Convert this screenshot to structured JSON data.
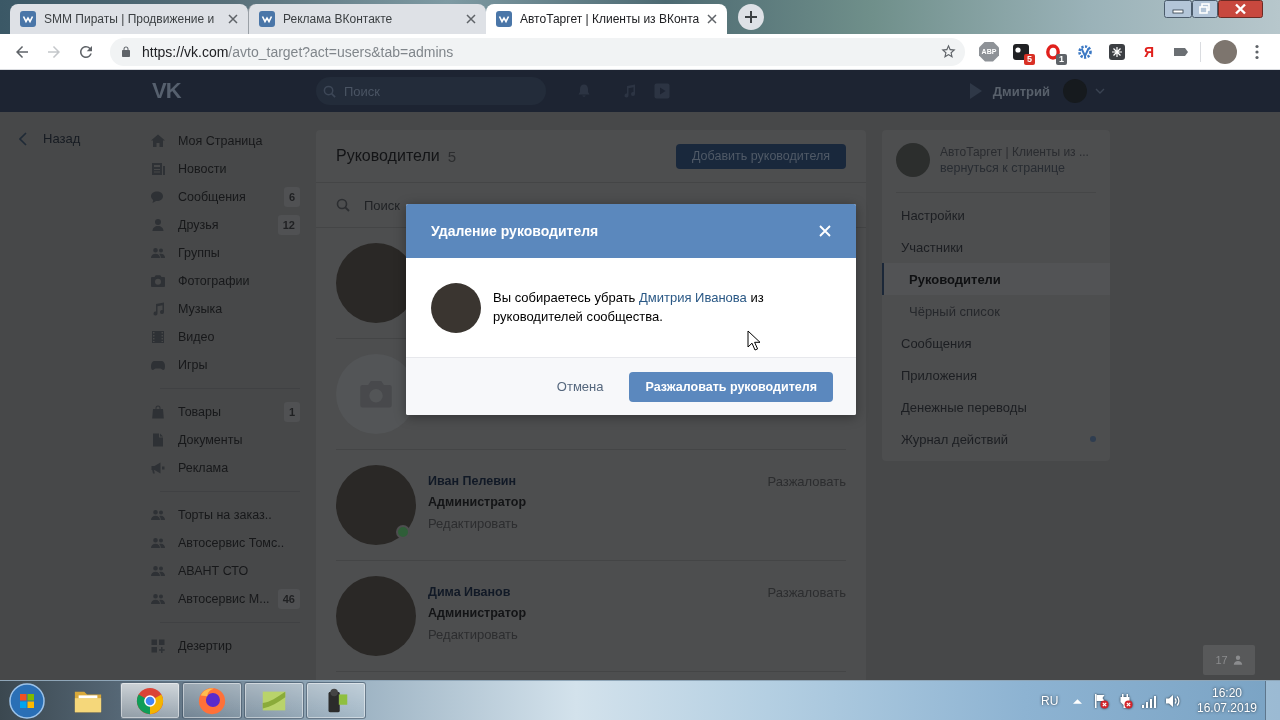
{
  "browser": {
    "tabs": [
      {
        "title": "SMM Пираты | Продвижение и",
        "selected": false
      },
      {
        "title": "Реклама ВКонтакте",
        "selected": false
      },
      {
        "title": "АвтоТаргет | Клиенты из ВКонта",
        "selected": true
      }
    ],
    "nav_buttons": [
      {
        "kind": "back",
        "disabled": false
      },
      {
        "kind": "forward",
        "disabled": true
      },
      {
        "kind": "reload",
        "disabled": false
      }
    ],
    "url_host": "https://vk.com",
    "url_path": "/avto_target?act=users&tab=admins",
    "extensions": [
      {
        "kind": "abp",
        "label": "ABP"
      },
      {
        "kind": "square",
        "badge": "5",
        "color": "#d93025"
      },
      {
        "kind": "ring",
        "badge": "1",
        "color": "#5f6368"
      },
      {
        "kind": "gear"
      },
      {
        "kind": "spider"
      },
      {
        "kind": "letter",
        "label": "Я"
      },
      {
        "kind": "tag"
      }
    ]
  },
  "site_header": {
    "logo": "VK",
    "search": {
      "placeholder": "Поиск"
    },
    "user_name": "Дмитрий"
  },
  "sidebar": {
    "back": "Назад",
    "sections": [
      {
        "items": [
          {
            "kind": "home",
            "label": "Моя Страница"
          },
          {
            "kind": "news",
            "label": "Новости"
          },
          {
            "kind": "messages",
            "label": "Сообщения",
            "badge": "6"
          },
          {
            "kind": "friends",
            "label": "Друзья",
            "badge": "12"
          },
          {
            "kind": "groups",
            "label": "Группы"
          },
          {
            "kind": "photos",
            "label": "Фотографии"
          },
          {
            "kind": "music",
            "label": "Музыка"
          },
          {
            "kind": "video",
            "label": "Видео"
          },
          {
            "kind": "games",
            "label": "Игры"
          }
        ]
      },
      {
        "items": [
          {
            "kind": "market",
            "label": "Товары",
            "badge": "1"
          },
          {
            "kind": "docs",
            "label": "Документы"
          },
          {
            "kind": "ads",
            "label": "Реклама"
          }
        ]
      },
      {
        "items": [
          {
            "kind": "community",
            "label": "Торты на заказ.."
          },
          {
            "kind": "community",
            "label": "Автосервис Томс.."
          },
          {
            "kind": "community",
            "label": "АВАНТ СТО"
          },
          {
            "kind": "community",
            "label": "Автосервис М...",
            "badge": "46"
          }
        ]
      },
      {
        "items": [
          {
            "kind": "apps",
            "label": "Дезертир"
          }
        ]
      }
    ]
  },
  "admins": {
    "title": "Руководители",
    "count": "5",
    "add_button": "Добавить руководителя",
    "search": {
      "placeholder": "Поиск"
    },
    "members": [
      {
        "kind": "photo"
      },
      {
        "kind": "placeholder"
      },
      {
        "kind": "photo",
        "name": "Иван Пелевин",
        "role": "Администратор",
        "edit": "Редактировать",
        "action": "Разжаловать",
        "online": true
      },
      {
        "kind": "photo",
        "name": "Дима Иванов",
        "role": "Администратор",
        "edit": "Редактировать",
        "action": "Разжаловать",
        "online": false
      }
    ]
  },
  "community_menu": {
    "name": "АвтоТаргет | Клиенты из ...",
    "back_link": "вернуться к странице",
    "items": [
      {
        "label": "Настройки",
        "selected": false,
        "unread": false
      },
      {
        "label": "Участники",
        "selected": false,
        "unread": false,
        "children": [
          {
            "label": "Руководители",
            "selected": true,
            "unread": false
          },
          {
            "label": "Чёрный список",
            "selected": false,
            "unread": false
          }
        ]
      },
      {
        "label": "Сообщения",
        "selected": false,
        "unread": false
      },
      {
        "label": "Приложения",
        "selected": false,
        "unread": false
      },
      {
        "label": "Денежные переводы",
        "selected": false,
        "unread": false
      },
      {
        "label": "Журнал действий",
        "selected": false,
        "unread": true
      }
    ]
  },
  "online_friends": "17",
  "dialog": {
    "title": "Удаление руководителя",
    "message_before": "Вы собираетесь убрать",
    "message_link": "Дмитрия Иванова",
    "message_after": "из руководителей сообщества.",
    "cancel": "Отмена",
    "confirm": "Разжаловать руководителя"
  },
  "taskbar": {
    "apps": [
      {
        "kind": "folder",
        "running": false,
        "selected": false
      },
      {
        "kind": "browser",
        "running": true,
        "selected": true
      },
      {
        "kind": "fox",
        "running": true,
        "selected": false
      },
      {
        "kind": "leaf",
        "running": true,
        "selected": false
      },
      {
        "kind": "camcorder",
        "running": true,
        "selected": false
      }
    ],
    "language": "RU",
    "time": "16:20",
    "date": "16.07.2019"
  }
}
